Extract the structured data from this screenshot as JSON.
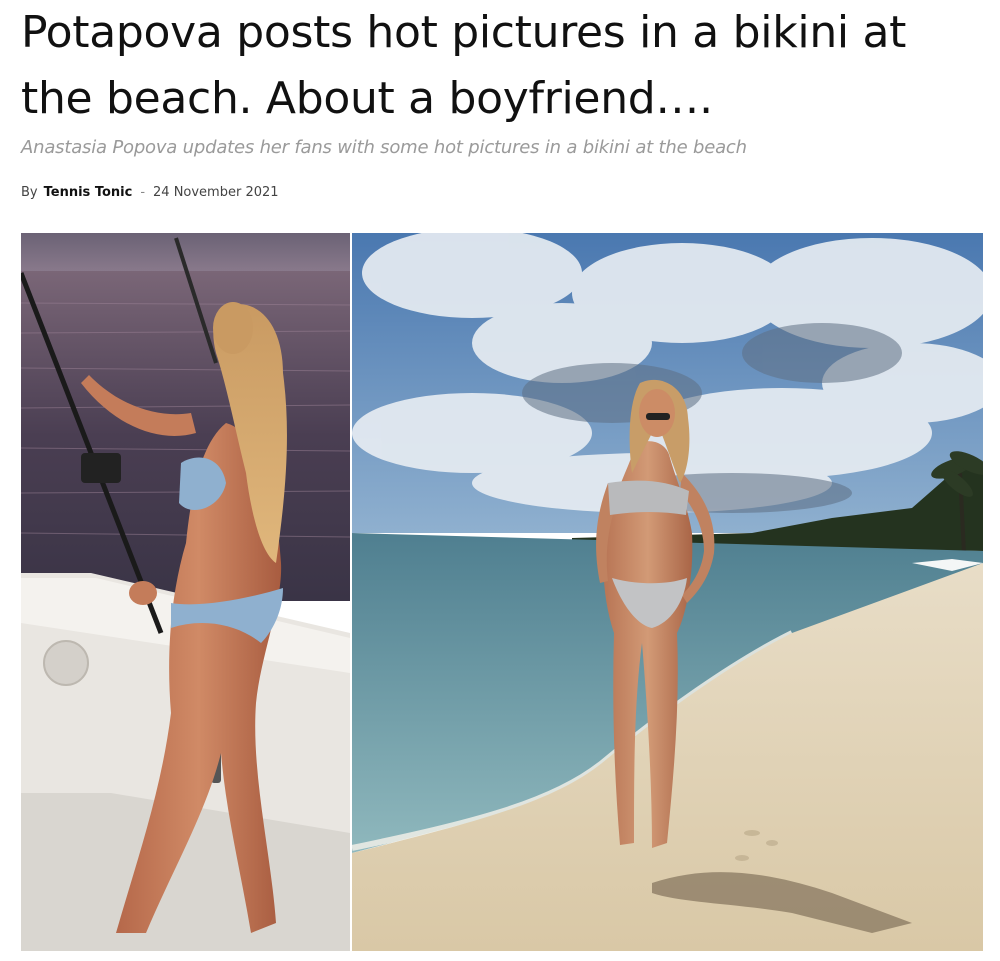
{
  "article": {
    "title": "Potapova posts hot pictures in a bikini at the beach. About a boyfriend….",
    "subtitle": "Anastasia Popova updates her fans with some hot pictures in a bikini at the beach",
    "by_label": "By",
    "author": "Tennis Tonic",
    "separator": "-",
    "date": "24 November 2021"
  },
  "images": {
    "left": {
      "scene": "woman-fishing-on-boat"
    },
    "right": {
      "scene": "woman-on-beach"
    }
  }
}
